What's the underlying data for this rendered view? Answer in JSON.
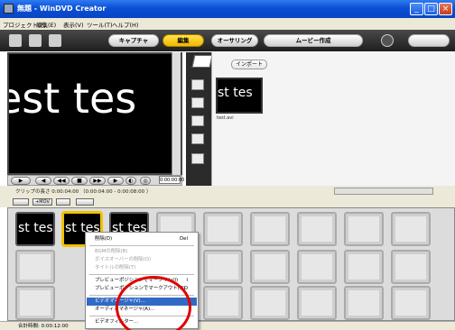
{
  "window": {
    "title": "無題 - WinDVD Creator"
  },
  "menu": [
    "プロジェクト(P)",
    "編集(E)",
    "表示(V)",
    "ツール(T)",
    "ヘルプ(H)"
  ],
  "tabs": [
    "キャプチャ",
    "編集",
    "オーサリング",
    "ムービー作成"
  ],
  "preview": {
    "text": "est tes",
    "timecode": "0:00:00:00"
  },
  "library": {
    "import_label": "インポート",
    "thumb_text": "st tes",
    "file_name": "test.avi"
  },
  "clip_length": "クリップの長さ 0:00:04:00 （0:00:04:00 - 0:00:08:00 ）",
  "storyboard": {
    "clip_texts": [
      "st tes",
      "st tes",
      "st tes"
    ],
    "toolbar": [
      "",
      "+MOV",
      "",
      ""
    ]
  },
  "total_time": "合計時間: 0:00:12:00",
  "context_menu": {
    "items": [
      {
        "label": "削除(D)",
        "shortcut": "Del",
        "enabled": true
      },
      {
        "label": "BGMの削除(B)",
        "shortcut": "",
        "enabled": false
      },
      {
        "label": "ボイスオーバーの削除(O)",
        "shortcut": "",
        "enabled": false
      },
      {
        "label": "タイトルの削除(T)",
        "shortcut": "",
        "enabled": false
      },
      {
        "label": "プレビューポジションでマークイン(I)",
        "shortcut": "I",
        "enabled": true
      },
      {
        "label": "プレビューポジションでマークアウト(O)",
        "shortcut": "O",
        "enabled": true
      },
      {
        "label": "ビデオマネージャ(V)...",
        "shortcut": "",
        "enabled": true,
        "highlighted": true
      },
      {
        "label": "オーディオマネージャ(A)...",
        "shortcut": "",
        "enabled": true
      },
      {
        "label": "ビデオフィルター...",
        "shortcut": "F",
        "enabled": true
      }
    ]
  },
  "colors": {
    "title_bar": "#0a4fd6",
    "active_tab": "#f0b700",
    "selection": "#316ac5",
    "annotation_circle": "#e00000"
  }
}
